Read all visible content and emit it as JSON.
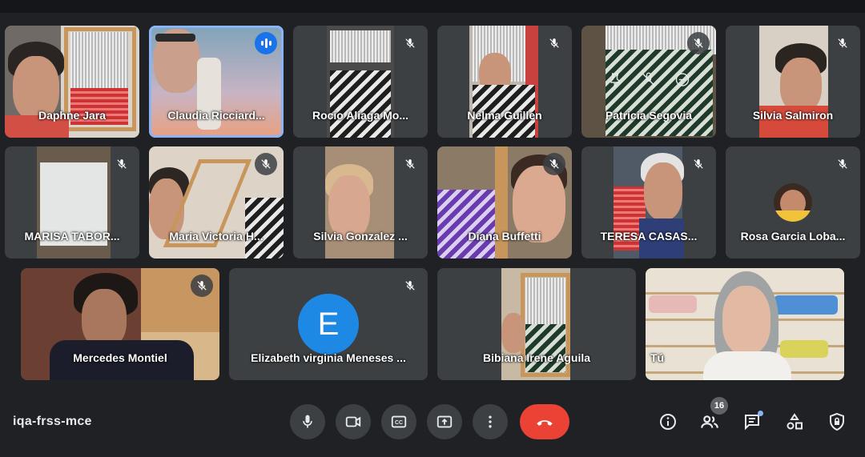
{
  "meeting_code": "iqa-frss-mce",
  "participant_count": "16",
  "participants": [
    {
      "name": "Daphne Jara",
      "mic": "none"
    },
    {
      "name": "Claudia Ricciard...",
      "mic": "speaking"
    },
    {
      "name": "Rocio Aliaga Mo...",
      "mic": "muted"
    },
    {
      "name": "Nelma Guillen",
      "mic": "muted"
    },
    {
      "name": "Patricia Segovia",
      "mic": "muted"
    },
    {
      "name": "Silvia Salmiron",
      "mic": "muted"
    },
    {
      "name": "MARISA TABOR...",
      "mic": "muted"
    },
    {
      "name": "Maria Victoria H...",
      "mic": "muted"
    },
    {
      "name": "Silvia Gonzalez ...",
      "mic": "muted"
    },
    {
      "name": "Diana Buffetti",
      "mic": "muted"
    },
    {
      "name": "TERESA CASAS...",
      "mic": "muted"
    },
    {
      "name": "Rosa Garcia Loba...",
      "mic": "muted"
    },
    {
      "name": "Mercedes Montiel",
      "mic": "muted"
    },
    {
      "name": "Elizabeth virginia Meneses ...",
      "mic": "muted",
      "avatar_letter": "E"
    },
    {
      "name": "Bibiana Irene Aguila",
      "mic": "none"
    },
    {
      "name": "Tú",
      "mic": "none"
    }
  ],
  "colors": {
    "background": "#202124",
    "tile": "#3c4043",
    "active_speaker_border": "#8ab4f8",
    "speaking_indicator": "#1a73e8",
    "end_call": "#ea4335",
    "avatar_e": "#1e88e5"
  },
  "controls": [
    {
      "name": "microphone",
      "icon": "mic-icon"
    },
    {
      "name": "camera",
      "icon": "camera-icon"
    },
    {
      "name": "captions",
      "icon": "cc-icon"
    },
    {
      "name": "present",
      "icon": "present-icon"
    },
    {
      "name": "more",
      "icon": "more-vert-icon"
    },
    {
      "name": "leave-call",
      "icon": "phone-hangup-icon"
    }
  ],
  "side_controls": [
    {
      "name": "meeting-details",
      "icon": "info-icon"
    },
    {
      "name": "people",
      "icon": "people-icon"
    },
    {
      "name": "chat",
      "icon": "chat-icon"
    },
    {
      "name": "activities",
      "icon": "shapes-icon"
    },
    {
      "name": "host-controls",
      "icon": "shield-lock-icon"
    }
  ]
}
